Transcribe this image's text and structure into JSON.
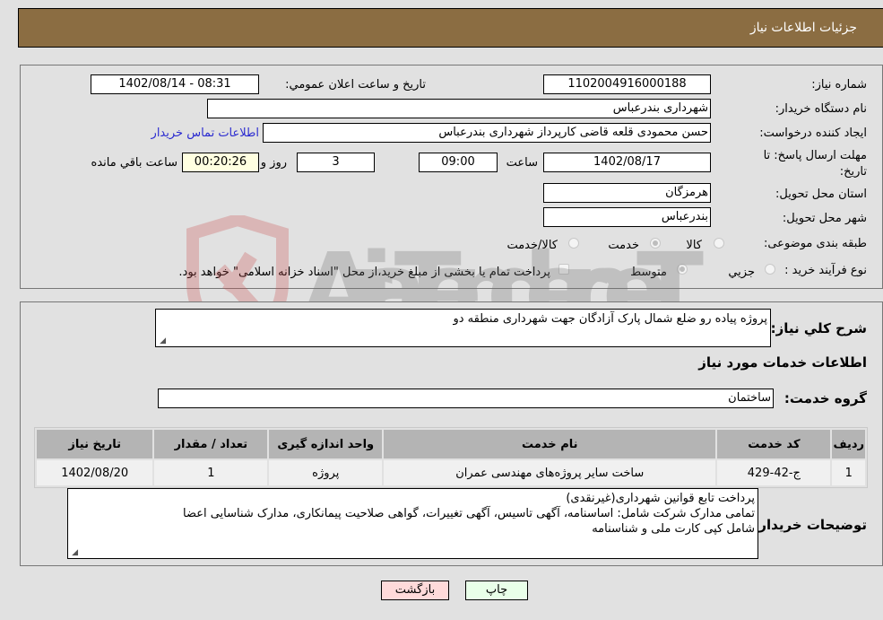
{
  "header": {
    "title": "جزئیات اطلاعات نیاز"
  },
  "details": {
    "need_number": {
      "label": "شماره نیاز:",
      "value": "1102004916000188"
    },
    "announce_datetime": {
      "label": "تاریخ و ساعت اعلان عمومي:",
      "value": "1402/08/14 - 08:31"
    },
    "buyer_org": {
      "label": "نام دستگاه خریدار:",
      "value": "شهرداری بندرعباس"
    },
    "creator": {
      "label": "ایجاد کننده درخواست:",
      "value": "حسن محمودی قلعه قاضی کارپرداز شهرداری بندرعباس",
      "contact_link": "اطلاعات تماس خریدار"
    },
    "deadline": {
      "label": "مهلت ارسال پاسخ: تا تاریخ:",
      "date": "1402/08/17",
      "time_label": "ساعت",
      "time": "09:00",
      "days": "3",
      "days_label": "روز و",
      "remaining": "00:20:26",
      "remaining_label": "ساعت باقي مانده"
    },
    "province": {
      "label": "استان محل تحویل:",
      "value": "هرمزگان"
    },
    "city": {
      "label": "شهر محل تحویل:",
      "value": "بندرعباس"
    },
    "category": {
      "label": "طبقه بندی موضوعی:",
      "options": [
        {
          "label": "کالا",
          "checked": false
        },
        {
          "label": "خدمت",
          "checked": true
        },
        {
          "label": "کالا/خدمت",
          "checked": false
        }
      ]
    },
    "purchase_process": {
      "label": "نوع فرآیند خرید :",
      "options": [
        {
          "label": "جزيي",
          "checked": false
        },
        {
          "label": "متوسط",
          "checked": true
        }
      ],
      "treasury_checkbox": {
        "label": "پرداخت تمام یا بخشی از مبلغ خرید،از محل \"اسناد خزانه اسلامی\" خواهد بود.",
        "checked": false
      }
    }
  },
  "description": {
    "label": "شرح کلي نیاز:",
    "value": "پروژه پیاده رو ضلع شمال پارک آزادگان جهت شهرداری منطقه دو"
  },
  "services_section": {
    "title": "اطلاعات خدمات مورد نیاز"
  },
  "service_group": {
    "label": "گروه خدمت:",
    "value": "ساختمان"
  },
  "table": {
    "headers": [
      "ردیف",
      "کد خدمت",
      "نام خدمت",
      "واحد اندازه گیری",
      "تعداد / مقدار",
      "تاریخ نیاز"
    ],
    "rows": [
      [
        "1",
        "ج-42-429",
        "ساخت سایر پروژه‌های مهندسی عمران",
        "پروژه",
        "1",
        "1402/08/20"
      ]
    ]
  },
  "buyer_notes": {
    "label": "توضیحات خریدار:",
    "lines": [
      "پرداخت تابع قوانین شهرداری(غیرنقدی)",
      "تمامی مدارک شرکت شامل: اساسنامه، آگهی تاسیس، آگهی تغییرات، گواهی صلاحیت پیمانکاری، مدارک شناسایی اعضا",
      "شامل کپی کارت ملی و شناسنامه"
    ]
  },
  "buttons": {
    "print": "چاپ",
    "back": "بازگشت"
  },
  "watermark": {
    "text": "AriaTender.neT"
  }
}
